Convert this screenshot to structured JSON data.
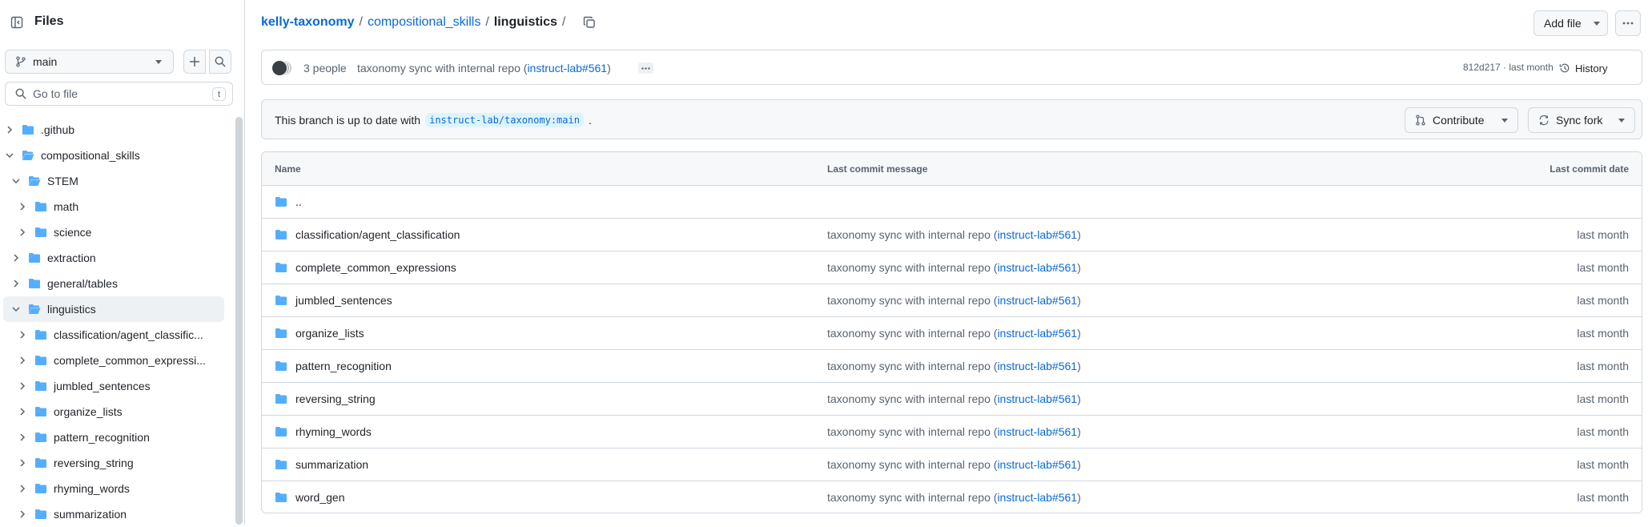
{
  "sidebar": {
    "title": "Files",
    "branch": "main",
    "goto_placeholder": "Go to file",
    "goto_shortcut": "t",
    "tree": [
      {
        "label": ".github",
        "level": 0,
        "expanded": false
      },
      {
        "label": "compositional_skills",
        "level": 0,
        "expanded": true
      },
      {
        "label": "STEM",
        "level": 1,
        "expanded": true
      },
      {
        "label": "math",
        "level": 2,
        "expanded": false
      },
      {
        "label": "science",
        "level": 2,
        "expanded": false
      },
      {
        "label": "extraction",
        "level": 1,
        "expanded": false
      },
      {
        "label": "general/tables",
        "level": 1,
        "expanded": false
      },
      {
        "label": "linguistics",
        "level": 1,
        "expanded": true,
        "selected": true
      },
      {
        "label": "classification/agent_classific...",
        "level": 2,
        "expanded": false
      },
      {
        "label": "complete_common_expressi...",
        "level": 2,
        "expanded": false
      },
      {
        "label": "jumbled_sentences",
        "level": 2,
        "expanded": false
      },
      {
        "label": "organize_lists",
        "level": 2,
        "expanded": false
      },
      {
        "label": "pattern_recognition",
        "level": 2,
        "expanded": false
      },
      {
        "label": "reversing_string",
        "level": 2,
        "expanded": false
      },
      {
        "label": "rhyming_words",
        "level": 2,
        "expanded": false
      },
      {
        "label": "summarization",
        "level": 2,
        "expanded": false
      }
    ]
  },
  "breadcrumb": {
    "repo": "kelly-taxonomy",
    "parts": [
      "compositional_skills"
    ],
    "current": "linguistics",
    "trailing": "/"
  },
  "header": {
    "add_file": "Add file"
  },
  "commit": {
    "people": "3 people",
    "message": "taxonomy sync with internal repo (",
    "link": "instruct-lab#561",
    "close": ")",
    "sha_time": "812d217 · last month",
    "history": "History"
  },
  "branch_status": {
    "prefix": "This branch is up to date with",
    "ref": "instruct-lab/taxonomy:main",
    "suffix": ".",
    "contribute": "Contribute",
    "sync_fork": "Sync fork"
  },
  "table": {
    "headers": {
      "name": "Name",
      "message": "Last commit message",
      "date": "Last commit date"
    },
    "parent": "..",
    "rows": [
      {
        "name": "classification/agent_classification",
        "msg": "taxonomy sync with internal repo (",
        "link": "instruct-lab#561",
        "close": ")",
        "date": "last month"
      },
      {
        "name": "complete_common_expressions",
        "msg": "taxonomy sync with internal repo (",
        "link": "instruct-lab#561",
        "close": ")",
        "date": "last month"
      },
      {
        "name": "jumbled_sentences",
        "msg": "taxonomy sync with internal repo (",
        "link": "instruct-lab#561",
        "close": ")",
        "date": "last month"
      },
      {
        "name": "organize_lists",
        "msg": "taxonomy sync with internal repo (",
        "link": "instruct-lab#561",
        "close": ")",
        "date": "last month"
      },
      {
        "name": "pattern_recognition",
        "msg": "taxonomy sync with internal repo (",
        "link": "instruct-lab#561",
        "close": ")",
        "date": "last month"
      },
      {
        "name": "reversing_string",
        "msg": "taxonomy sync with internal repo (",
        "link": "instruct-lab#561",
        "close": ")",
        "date": "last month"
      },
      {
        "name": "rhyming_words",
        "msg": "taxonomy sync with internal repo (",
        "link": "instruct-lab#561",
        "close": ")",
        "date": "last month"
      },
      {
        "name": "summarization",
        "msg": "taxonomy sync with internal repo (",
        "link": "instruct-lab#561",
        "close": ")",
        "date": "last month"
      },
      {
        "name": "word_gen",
        "msg": "taxonomy sync with internal repo (",
        "link": "instruct-lab#561",
        "close": ")",
        "date": "last month"
      }
    ]
  },
  "colors": {
    "folder": "#54aeff",
    "link": "#0969da",
    "muted": "#59636e",
    "border": "#d1d9e0"
  }
}
